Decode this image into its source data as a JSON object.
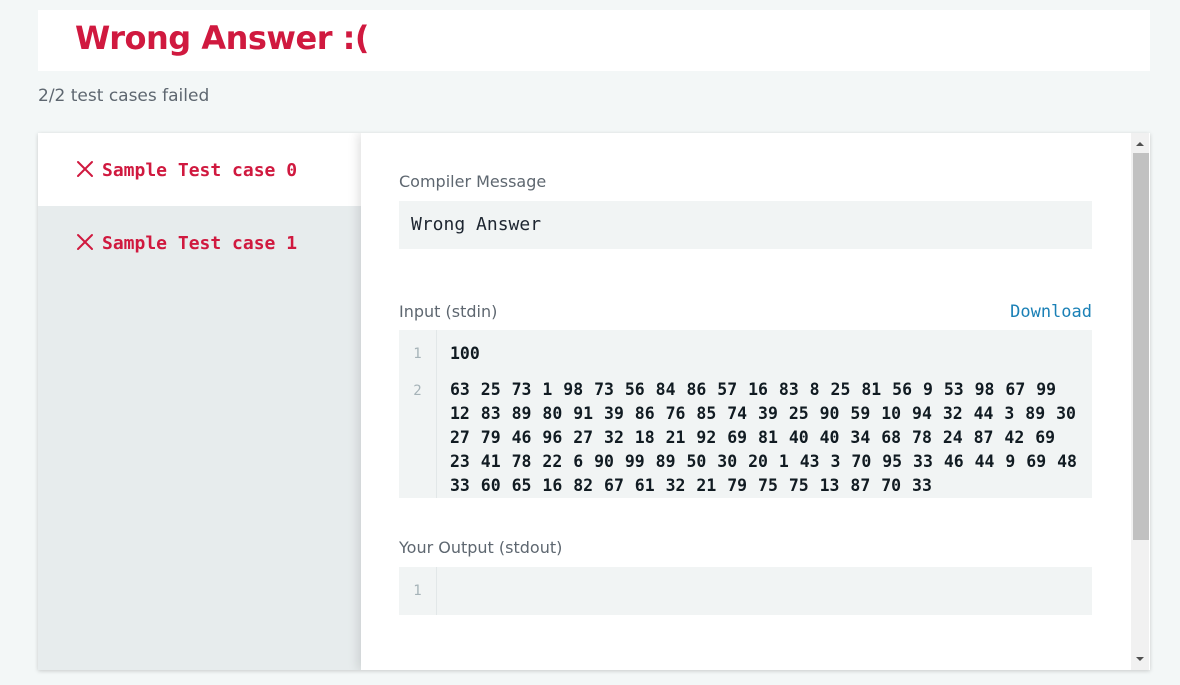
{
  "header": {
    "title": "Wrong Answer :(",
    "title_color": "#d0193f"
  },
  "summary": "2/2 test cases failed",
  "tabs": [
    {
      "label": "Sample Test case 0",
      "status": "failed",
      "icon": "x-icon",
      "active": true
    },
    {
      "label": "Sample Test case 1",
      "status": "failed",
      "icon": "x-icon",
      "active": false
    }
  ],
  "compiler": {
    "label": "Compiler Message",
    "message": "Wrong Answer"
  },
  "input": {
    "label": "Input (stdin)",
    "download_label": "Download",
    "lines": [
      {
        "no": "1",
        "text": "100"
      },
      {
        "no": "2",
        "text": "63 25 73 1 98 73 56 84 86 57 16 83 8 25 81 56 9 53 98 67 99 12 83 89 80 91 39 86 76 85 74 39 25 90 59 10 94 32 44 3 89 30 27 79 46 96 27 32 18 21 92 69 81 40 40 34 68 78 24 87 42 69 23 41 78 22 6 90 99 89 50 30 20 1 43 3 70 95 33 46 44 9 69 48 33 60 65 16 82 67 61 32 21 79 75 75 13 87 70 33"
      }
    ]
  },
  "output": {
    "label": "Your Output (stdout)",
    "lines": [
      {
        "no": "1",
        "text": ""
      }
    ]
  },
  "colors": {
    "error": "#d0193f",
    "link": "#1a80b6",
    "page_bg": "#f3f7f7",
    "code_bg": "#f1f4f4"
  }
}
